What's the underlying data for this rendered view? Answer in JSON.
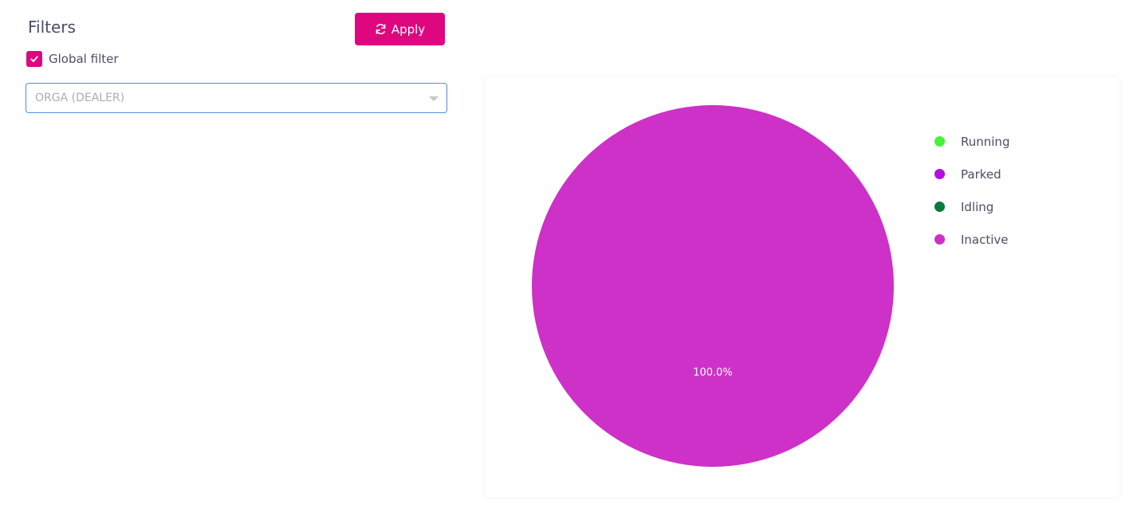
{
  "filters": {
    "title": "Filters",
    "apply_label": "Apply",
    "global_filter_label": "Global filter",
    "global_filter_checked": true,
    "organisation_value": "ORGA (DEALER)"
  },
  "colors": {
    "accent": "#de077f",
    "select_border": "#4f8fd9"
  },
  "icons": {
    "apply": "refresh-icon",
    "checkbox": "check-icon",
    "select": "chevron-down-icon"
  },
  "chart_data": {
    "type": "pie",
    "title": "",
    "legend_position": "right",
    "series": [
      {
        "name": "Running",
        "value": 0,
        "color": "#48f23a"
      },
      {
        "name": "Parked",
        "value": 0,
        "color": "#b50ee0"
      },
      {
        "name": "Idling",
        "value": 0,
        "color": "#0a7a3e"
      },
      {
        "name": "Inactive",
        "value": 100,
        "color": "#cd31c7"
      }
    ],
    "labels": [
      "100.0%"
    ]
  }
}
